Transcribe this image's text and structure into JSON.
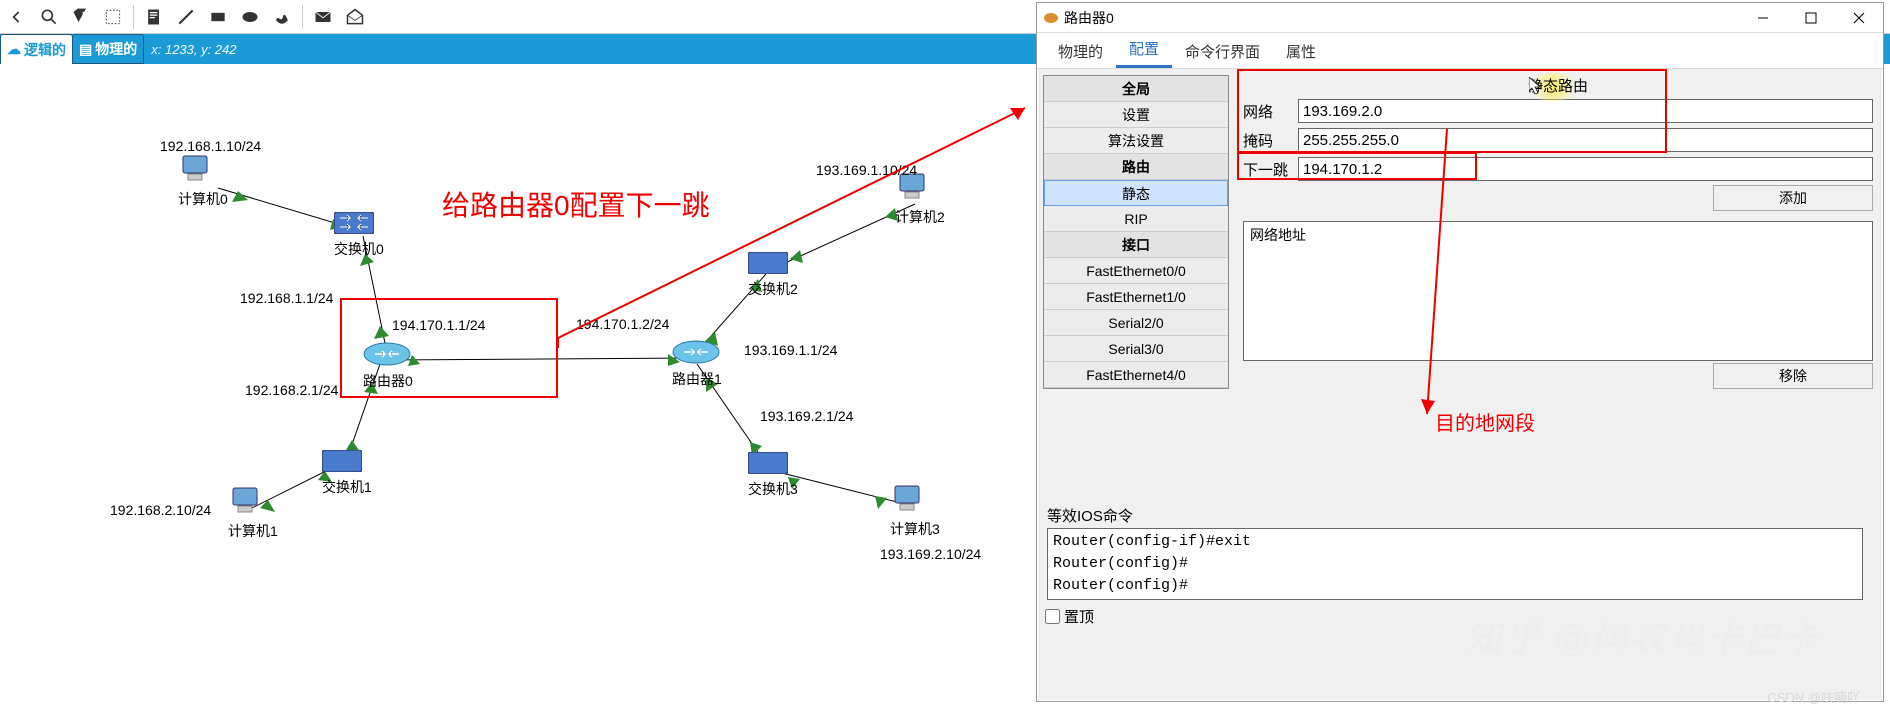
{
  "toolbar_icons": [
    "back",
    "search-icon",
    "delete-selector-icon",
    "resize-icon",
    "note-icon",
    "line-icon",
    "rect-icon",
    "ellipse-icon",
    "freeform-icon",
    "envelope-closed-icon",
    "envelope-open-icon"
  ],
  "bluebar": {
    "tabs": [
      "逻辑的",
      "物理的"
    ],
    "coord": "x: 1233, y: 242"
  },
  "annotations": {
    "config_title": "给路由器0配置下一跳",
    "dest_segment": "目的地网段"
  },
  "devices": {
    "pc0": {
      "name": "计算机0",
      "label": "192.168.1.10/24"
    },
    "sw0": {
      "name": "交换机0"
    },
    "r0": {
      "name": "路由器0",
      "left": "192.168.1.1/24",
      "r_left": "194.170.1.1/24",
      "down": "192.168.2.1/24"
    },
    "r1": {
      "name": "路由器1",
      "left": "194.170.1.2/24",
      "right": "193.169.1.1/24",
      "down": "193.169.2.1/24"
    },
    "sw1": {
      "name": "交换机1"
    },
    "pc1": {
      "name": "计算机1",
      "label": "192.168.2.10/24"
    },
    "sw2": {
      "name": "交换机2"
    },
    "pc2": {
      "name": "计算机2",
      "label": "193.169.1.10/24"
    },
    "sw3": {
      "name": "交换机3"
    },
    "pc3": {
      "name": "计算机3",
      "label": "193.169.2.10/24"
    }
  },
  "dialog": {
    "title": "路由器0",
    "tabs": [
      "物理的",
      "配置",
      "命令行界面",
      "属性"
    ],
    "active_tab": "配置",
    "left_panel": {
      "global_hd": "全局",
      "settings": "设置",
      "algo": "算法设置",
      "routing_hd": "路由",
      "static": "静态",
      "rip": "RIP",
      "iface_hd": "接口",
      "ifs": [
        "FastEthernet0/0",
        "FastEthernet1/0",
        "Serial2/0",
        "Serial3/0",
        "FastEthernet4/0"
      ]
    },
    "form": {
      "heading": "静态路由",
      "net_label": "网络",
      "net_value": "193.169.2.0",
      "mask_label": "掩码",
      "mask_value": "255.255.255.0",
      "hop_label": "下一跳",
      "hop_value": "194.170.1.2",
      "add_btn": "添加",
      "list_label": "网络地址",
      "remove_btn": "移除"
    },
    "ios": {
      "label": "等效IOS命令",
      "lines": "Router(config-if)#exit\nRouter(config)#\nRouter(config)#"
    },
    "pin_label": "置顶"
  },
  "watermark": "知乎 @码农玛卡巴卡",
  "footer_wm": "CSDN @呋喃吖"
}
